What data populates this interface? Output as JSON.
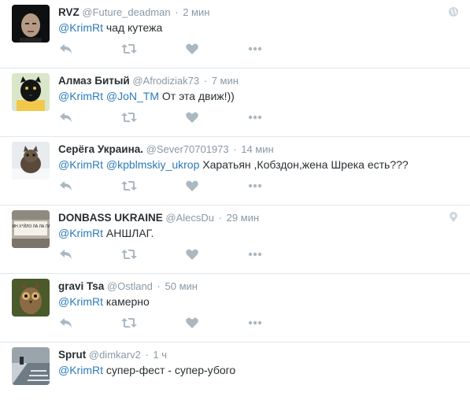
{
  "colors": {
    "mention": "#2b7bb9",
    "secondary_text": "#8899a6",
    "icon": "#aab8c2",
    "divider": "#e1e8ed"
  },
  "tweets": [
    {
      "name": "RVZ",
      "handle": "@Future_deadman",
      "time": "2 мин",
      "mentions": [
        "@KrimRt"
      ],
      "text": "чад кутежа",
      "corner_icon": "globe-icon",
      "avatar": "avatar-face-dark"
    },
    {
      "name": "Алмаз Битый",
      "handle": "@Afrodiziak73",
      "time": "7 мин",
      "mentions": [
        "@KrimRt",
        "@JoN_TM"
      ],
      "text": "От эта движ!))",
      "corner_icon": "",
      "avatar": "avatar-panther"
    },
    {
      "name": "Серёга Украина.",
      "handle": "@Sever70701973",
      "time": "14 мин",
      "mentions": [
        "@KrimRt",
        "@kpblmskiy_ukrop"
      ],
      "text": "Харатьян ,Кобздон,жена Шрека есть???",
      "corner_icon": "",
      "avatar": "avatar-kitten"
    },
    {
      "name": "DONBASS UKRAINE",
      "handle": "@AlecsDu",
      "time": "29 мин",
      "mentions": [
        "@KrimRt"
      ],
      "text": "АНШЛАГ.",
      "corner_icon": "location-pin-icon",
      "avatar": "avatar-sign"
    },
    {
      "name": "gravi Tsa",
      "handle": "@Ostland",
      "time": "50 мин",
      "mentions": [
        "@KrimRt"
      ],
      "text": "камерно",
      "corner_icon": "",
      "avatar": "avatar-owl"
    },
    {
      "name": "Sprut",
      "handle": "@dimkarv2",
      "time": "1 ч",
      "mentions": [
        "@KrimRt"
      ],
      "text": "супер-фест - супер-убого",
      "corner_icon": "",
      "avatar": "avatar-street"
    }
  ],
  "avatar_sign_text": "ПУТИН Х*ЙЛО ЛА ЛА ЛА ЛА",
  "actions": [
    "reply-icon",
    "retweet-icon",
    "like-icon",
    "more-icon"
  ]
}
